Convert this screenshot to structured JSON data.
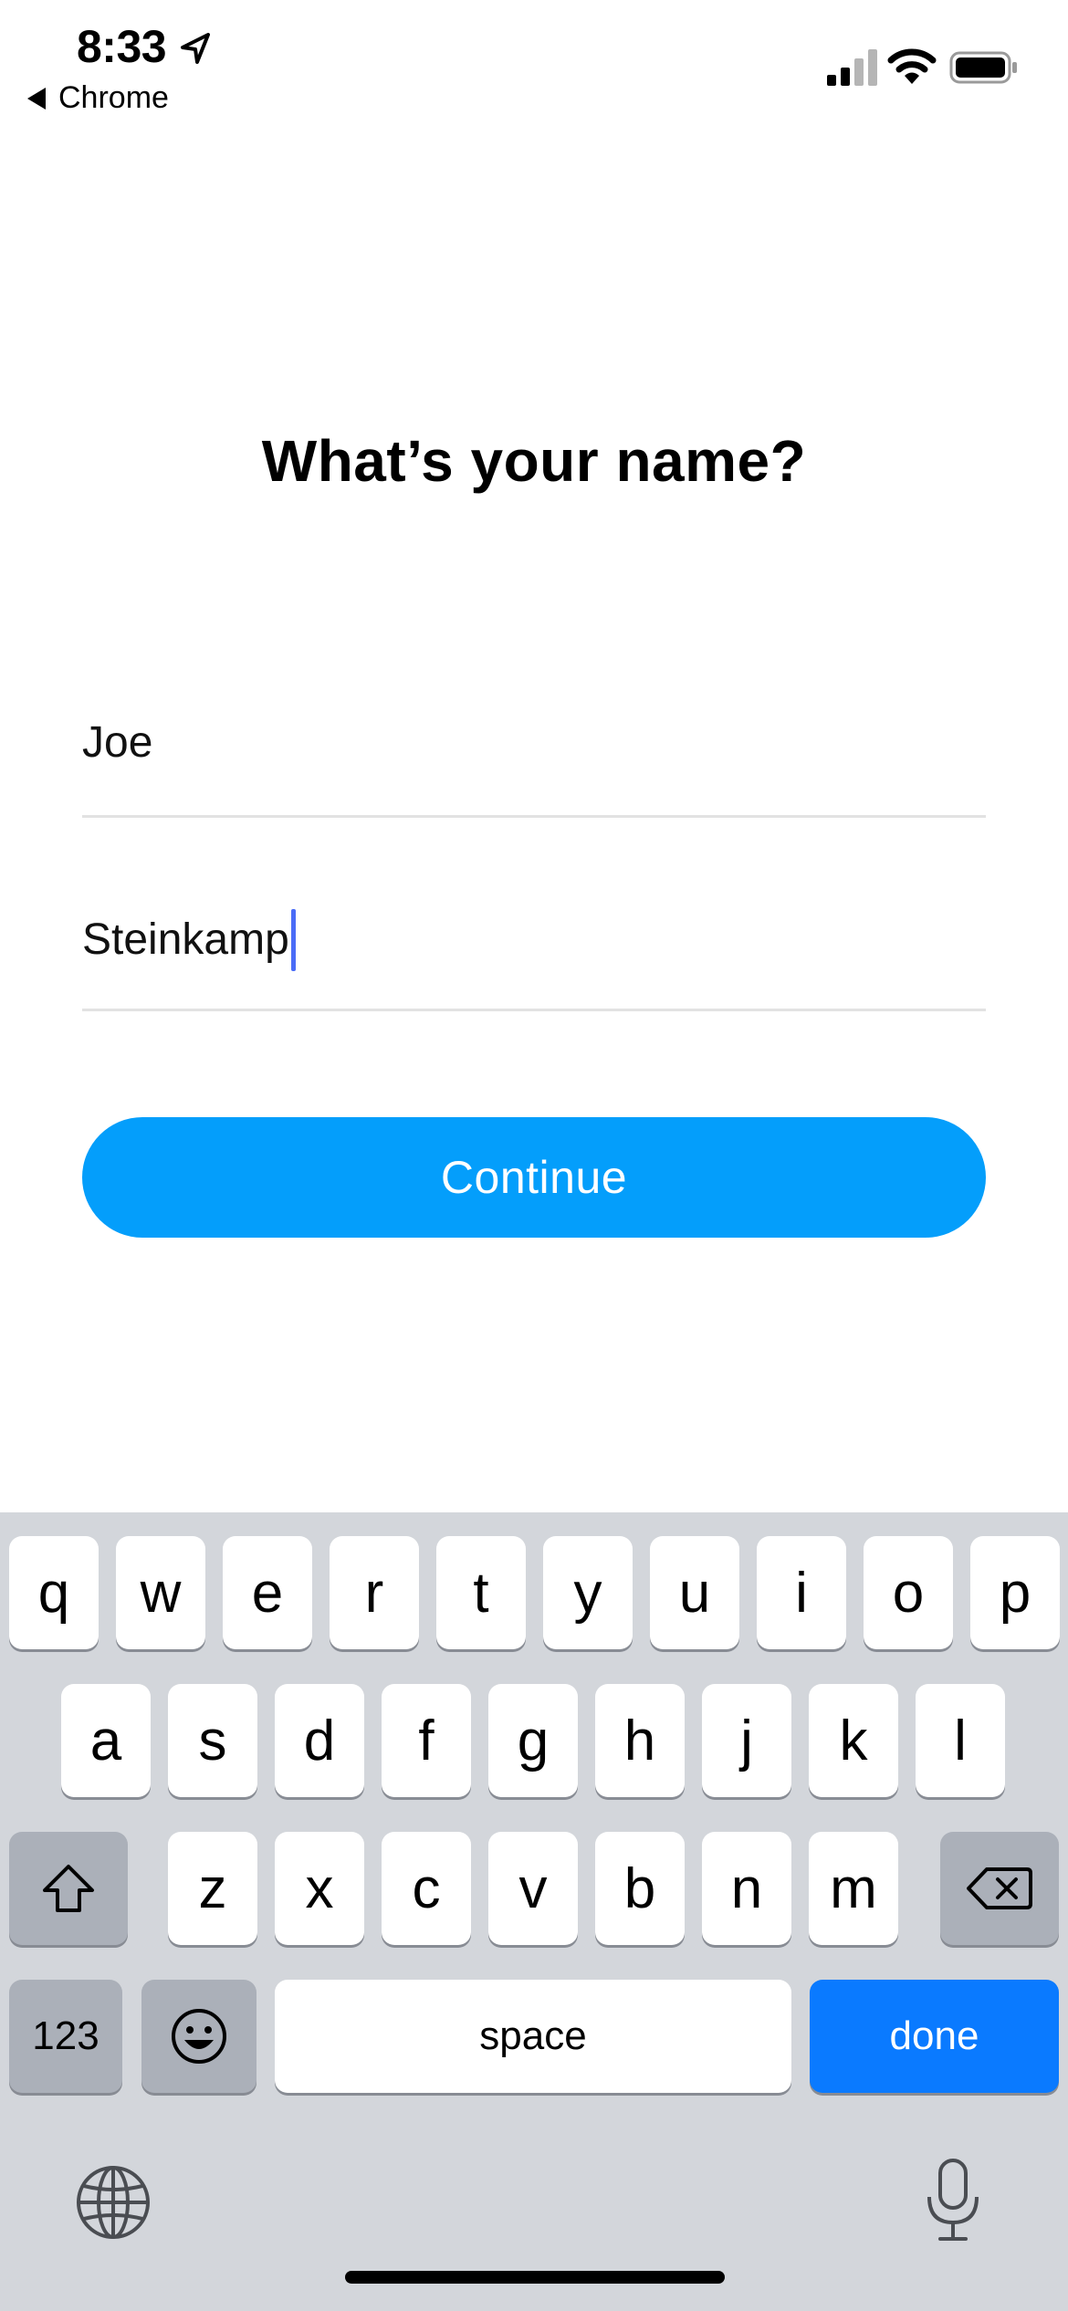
{
  "status_bar": {
    "time": "8:33",
    "back_app": "Chrome"
  },
  "page": {
    "title": "What’s your name?"
  },
  "form": {
    "first_name": "Joe",
    "last_name": "Steinkamp",
    "continue_label": "Continue",
    "accent_color": "#049efb"
  },
  "keyboard": {
    "row1": [
      "q",
      "w",
      "e",
      "r",
      "t",
      "y",
      "u",
      "i",
      "o",
      "p"
    ],
    "row2": [
      "a",
      "s",
      "d",
      "f",
      "g",
      "h",
      "j",
      "k",
      "l"
    ],
    "row3": [
      "z",
      "x",
      "c",
      "v",
      "b",
      "n",
      "m"
    ],
    "numbers_label": "123",
    "space_label": "space",
    "done_label": "done",
    "icons": [
      "shift-icon",
      "backspace-icon",
      "emoji-icon",
      "globe-icon",
      "microphone-icon"
    ]
  }
}
